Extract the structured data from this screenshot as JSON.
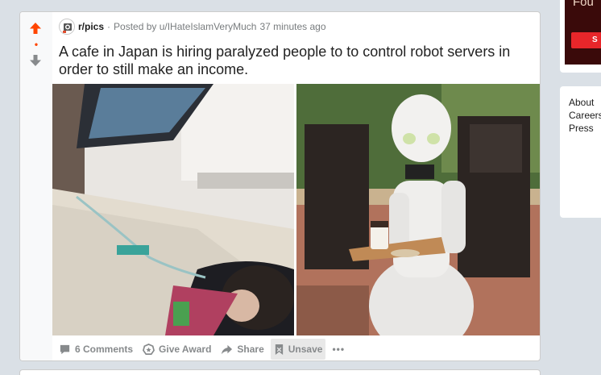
{
  "post": {
    "score": "•",
    "subreddit": "r/pics",
    "separator": "·",
    "posted_by": "Posted by u/IHateIslamVeryMuch",
    "time_ago": "37 minutes ago",
    "title": "A cafe in Japan is hiring paralyzed people to to control robot servers in order to still make an income.",
    "actions": {
      "comments": "6 Comments",
      "award": "Give Award",
      "share": "Share",
      "unsave": "Unsave",
      "more": "•••"
    }
  },
  "sidebar": {
    "promo_text": "Fou",
    "promo_button": "S",
    "footer_links": [
      "About",
      "Careers",
      "Press"
    ]
  },
  "colors": {
    "upvote": "#ff4500",
    "background": "#dae0e6",
    "meta_text": "#787c7e",
    "action_text": "#878a8c"
  },
  "icons": {
    "upvote": "arrow-up-icon",
    "downvote": "arrow-down-icon",
    "comments": "comment-icon",
    "award": "award-icon",
    "share": "share-icon",
    "unsave": "bookmark-icon"
  }
}
